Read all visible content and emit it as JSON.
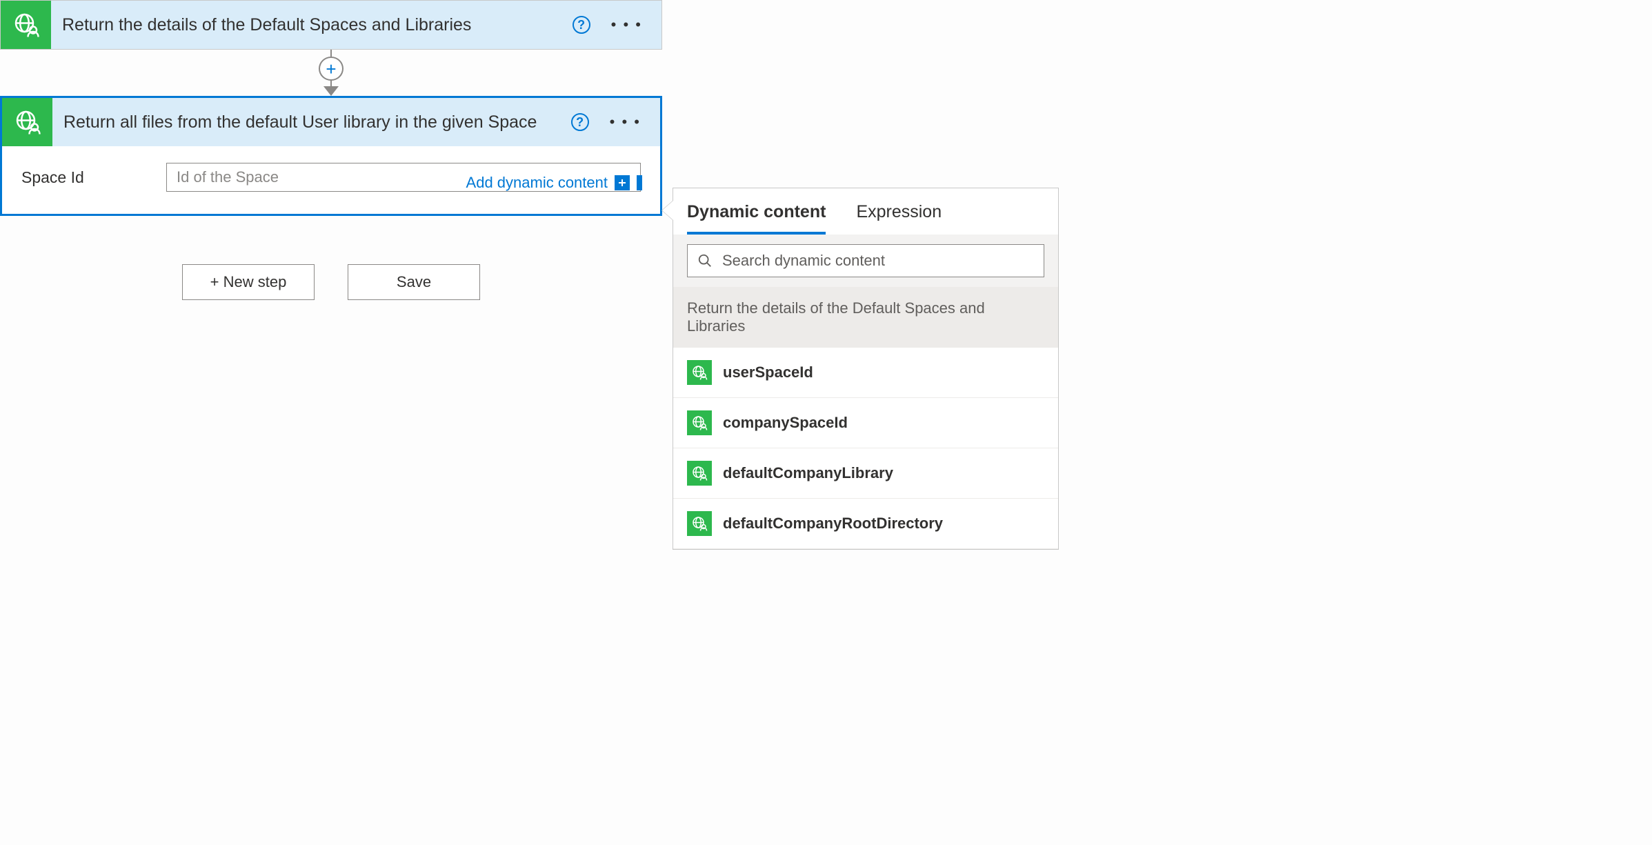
{
  "steps": [
    {
      "title": "Return the details of the Default Spaces and Libraries"
    },
    {
      "title": "Return all files from the default User library in the given Space",
      "param_label": "Space Id",
      "param_placeholder": "Id of the Space",
      "add_dynamic_label": "Add dynamic content"
    }
  ],
  "buttons": {
    "new_step": "+ New step",
    "save": "Save"
  },
  "dc": {
    "tabs": {
      "dynamic": "Dynamic content",
      "expression": "Expression"
    },
    "search_placeholder": "Search dynamic content",
    "section_title": "Return the details of the Default Spaces and Libraries",
    "items": [
      {
        "name": "userSpaceId"
      },
      {
        "name": "companySpaceId"
      },
      {
        "name": "defaultCompanyLibrary"
      },
      {
        "name": "defaultCompanyRootDirectory"
      }
    ]
  }
}
